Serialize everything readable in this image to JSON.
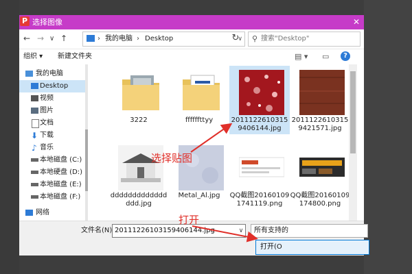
{
  "window": {
    "title": "选择图像",
    "close_glyph": "✕"
  },
  "nav": {
    "back_glyph": "←",
    "forward_glyph": "→",
    "dropdown_glyph": "∨",
    "up_glyph": "↑",
    "breadcrumb": [
      "我的电脑",
      "Desktop"
    ],
    "breadcrumb_sep": "›",
    "refresh_glyph": "↻",
    "search_placeholder": "搜索\"Desktop\""
  },
  "toolbar": {
    "organize_label": "组织 ▾",
    "new_folder_label": "新建文件夹"
  },
  "sidebar": {
    "items": [
      {
        "label": "我的电脑",
        "icon": "computer-icon",
        "color": "#4a90d9"
      },
      {
        "label": "Desktop",
        "icon": "desktop-icon",
        "color": "#2d7bd6"
      },
      {
        "label": "视频",
        "icon": "video-icon",
        "color": "#555555"
      },
      {
        "label": "图片",
        "icon": "pictures-icon",
        "color": "#555555"
      },
      {
        "label": "文档",
        "icon": "documents-icon",
        "color": "#777777"
      },
      {
        "label": "下载",
        "icon": "download-icon",
        "color": "#2d7bd6"
      },
      {
        "label": "音乐",
        "icon": "music-icon",
        "color": "#2d7bd6"
      },
      {
        "label": "本地磁盘 (C:)",
        "icon": "drive-icon",
        "color": "#555555"
      },
      {
        "label": "本地硬盘 (D:)",
        "icon": "drive-icon",
        "color": "#555555"
      },
      {
        "label": "本地磁盘 (E:)",
        "icon": "drive-icon",
        "color": "#555555"
      },
      {
        "label": "本地磁盘 (F:)",
        "icon": "drive-icon",
        "color": "#555555"
      },
      {
        "label": "网络",
        "icon": "network-icon",
        "color": "#2d7bd6"
      }
    ]
  },
  "files": [
    {
      "name": "3222",
      "kind": "folder"
    },
    {
      "name": "ffffffttyy",
      "kind": "folder"
    },
    {
      "name": "201112261031594061 44.jpg",
      "kind": "red-texture"
    },
    {
      "name": "201112261031594215 71.jpg",
      "kind": "brown-texture"
    },
    {
      "name": "dddddddddddddddd.jpg",
      "kind": "house"
    },
    {
      "name": "Metal_Al.jpg",
      "kind": "metal"
    },
    {
      "name": "QQ截图20160109174119.png",
      "kind": "screenshot"
    },
    {
      "name": "QQ截图20160109174800.png",
      "kind": "screenshot2"
    }
  ],
  "files_display": [
    "3222",
    "ffffffttyy",
    "20111226103159406144.jpg",
    "20111226103159421571.jpg",
    "dddddddddddddddd.jpg",
    "Metal_Al.jpg",
    "QQ截图201601091741119.png",
    "QQ截图20160109174800.png"
  ],
  "footer": {
    "filename_label": "文件名(N):",
    "filename_value": "20111226103159406144.jpg",
    "filter_label": "所有支持的",
    "open_label": "打开(O"
  },
  "annotations": {
    "select": "选择贴图",
    "open": "打开"
  },
  "colors": {
    "titlebar": "#c63bc8",
    "selection": "#cce4f7",
    "annotation": "#e0302a"
  }
}
